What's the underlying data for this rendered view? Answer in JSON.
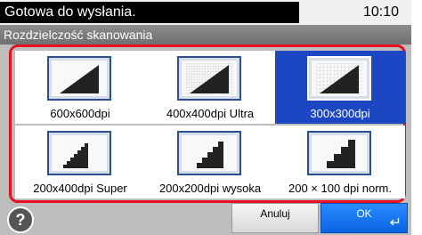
{
  "status": {
    "message": "Gotowa do wysłania.",
    "time": "10:10"
  },
  "subtitle": "Rozdzielczość skanowania",
  "options": [
    {
      "label": "600x600dpi",
      "selected": false,
      "icon": "dpi-600-icon"
    },
    {
      "label": "400x400dpi Ultra",
      "selected": false,
      "icon": "dpi-400-icon"
    },
    {
      "label": "300x300dpi",
      "selected": true,
      "icon": "dpi-300-icon"
    },
    {
      "label": "200x400dpi Super",
      "selected": false,
      "icon": "dpi-200x400-icon"
    },
    {
      "label": "200x200dpi wysoka",
      "selected": false,
      "icon": "dpi-200-icon"
    },
    {
      "label": "200 × 100 dpi norm.",
      "selected": false,
      "icon": "dpi-200x100-icon"
    }
  ],
  "buttons": {
    "help": "?",
    "cancel": "Anuluj",
    "ok": "OK",
    "enter_symbol": "↵"
  },
  "colors": {
    "selected": "#1b47c2",
    "frame": "#e8101e",
    "ok": "#0a63e0"
  }
}
